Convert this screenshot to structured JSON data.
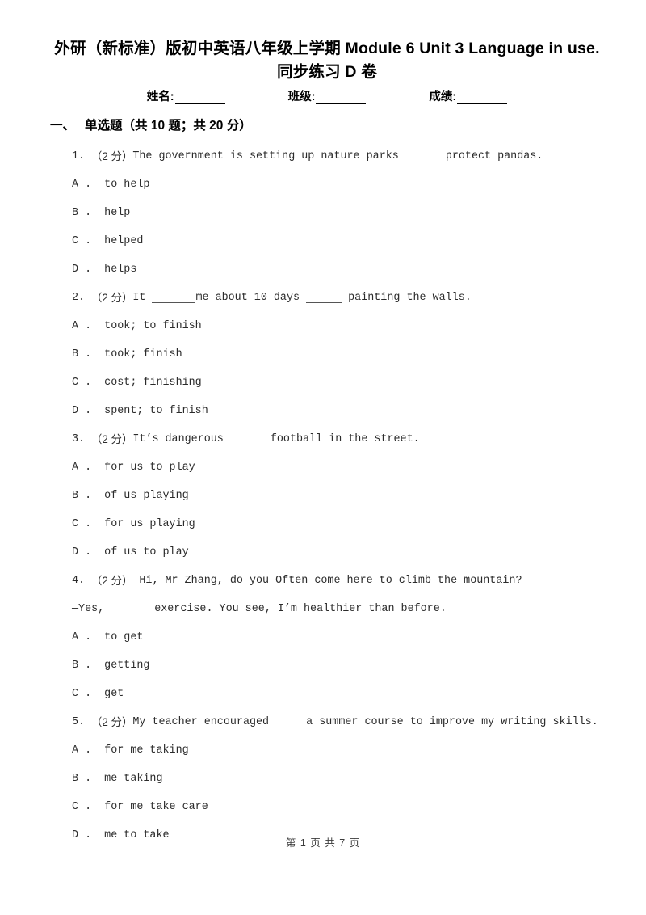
{
  "document": {
    "title_line1": "外研（新标准）版初中英语八年级上学期 Module 6 Unit 3 Language in use.",
    "title_line2": "同步练习 D 卷"
  },
  "student_info": {
    "name_label": "姓名:",
    "class_label": "班级:",
    "score_label": "成绩:"
  },
  "section": {
    "number": "一、",
    "title": "单选题（共 10 题；共 20 分）"
  },
  "questions": [
    {
      "number": "1.",
      "score": "（2 分）",
      "stem_before": "The government is setting up nature parks",
      "blank_type": "gap",
      "stem_after": "protect pandas.",
      "options": [
        {
          "key": "A",
          "text": "to help"
        },
        {
          "key": "B",
          "text": "help"
        },
        {
          "key": "C",
          "text": "helped"
        },
        {
          "key": "D",
          "text": "helps"
        }
      ]
    },
    {
      "number": "2.",
      "score": "（2 分）",
      "stem_before": "It",
      "blank_type": "double-underline",
      "stem_middle": "me about 10 days",
      "stem_after": "painting the walls.",
      "options": [
        {
          "key": "A",
          "text": "took; to finish"
        },
        {
          "key": "B",
          "text": "took; finish"
        },
        {
          "key": "C",
          "text": "cost; finishing"
        },
        {
          "key": "D",
          "text": "spent; to finish"
        }
      ]
    },
    {
      "number": "3.",
      "score": "（2 分）",
      "stem_before": "It’s dangerous",
      "blank_type": "gap",
      "stem_after": "football in the street.",
      "options": [
        {
          "key": "A",
          "text": "for us to play"
        },
        {
          "key": "B",
          "text": "of us playing"
        },
        {
          "key": "C",
          "text": "for us playing"
        },
        {
          "key": "D",
          "text": "of us to play"
        }
      ]
    },
    {
      "number": "4.",
      "score": "（2 分）",
      "stem_before": "—Hi, Mr Zhang, do you Often come here to climb the mountain?",
      "blank_type": "none",
      "stem_after": "",
      "continuation_before": "—Yes,",
      "continuation_after": "exercise. You see, I’m healthier than before.",
      "options": [
        {
          "key": "A",
          "text": "to get"
        },
        {
          "key": "B",
          "text": "getting"
        },
        {
          "key": "C",
          "text": "get"
        }
      ]
    },
    {
      "number": "5.",
      "score": "（2 分）",
      "stem_before": "My teacher encouraged",
      "blank_type": "underline",
      "stem_after": "a summer course to improve my writing skills.",
      "options": [
        {
          "key": "A",
          "text": "for me taking"
        },
        {
          "key": "B",
          "text": "me taking"
        },
        {
          "key": "C",
          "text": "for me take care"
        },
        {
          "key": "D",
          "text": "me to take"
        }
      ]
    }
  ],
  "footer": {
    "page_indicator": "第 1 页 共 7 页"
  }
}
